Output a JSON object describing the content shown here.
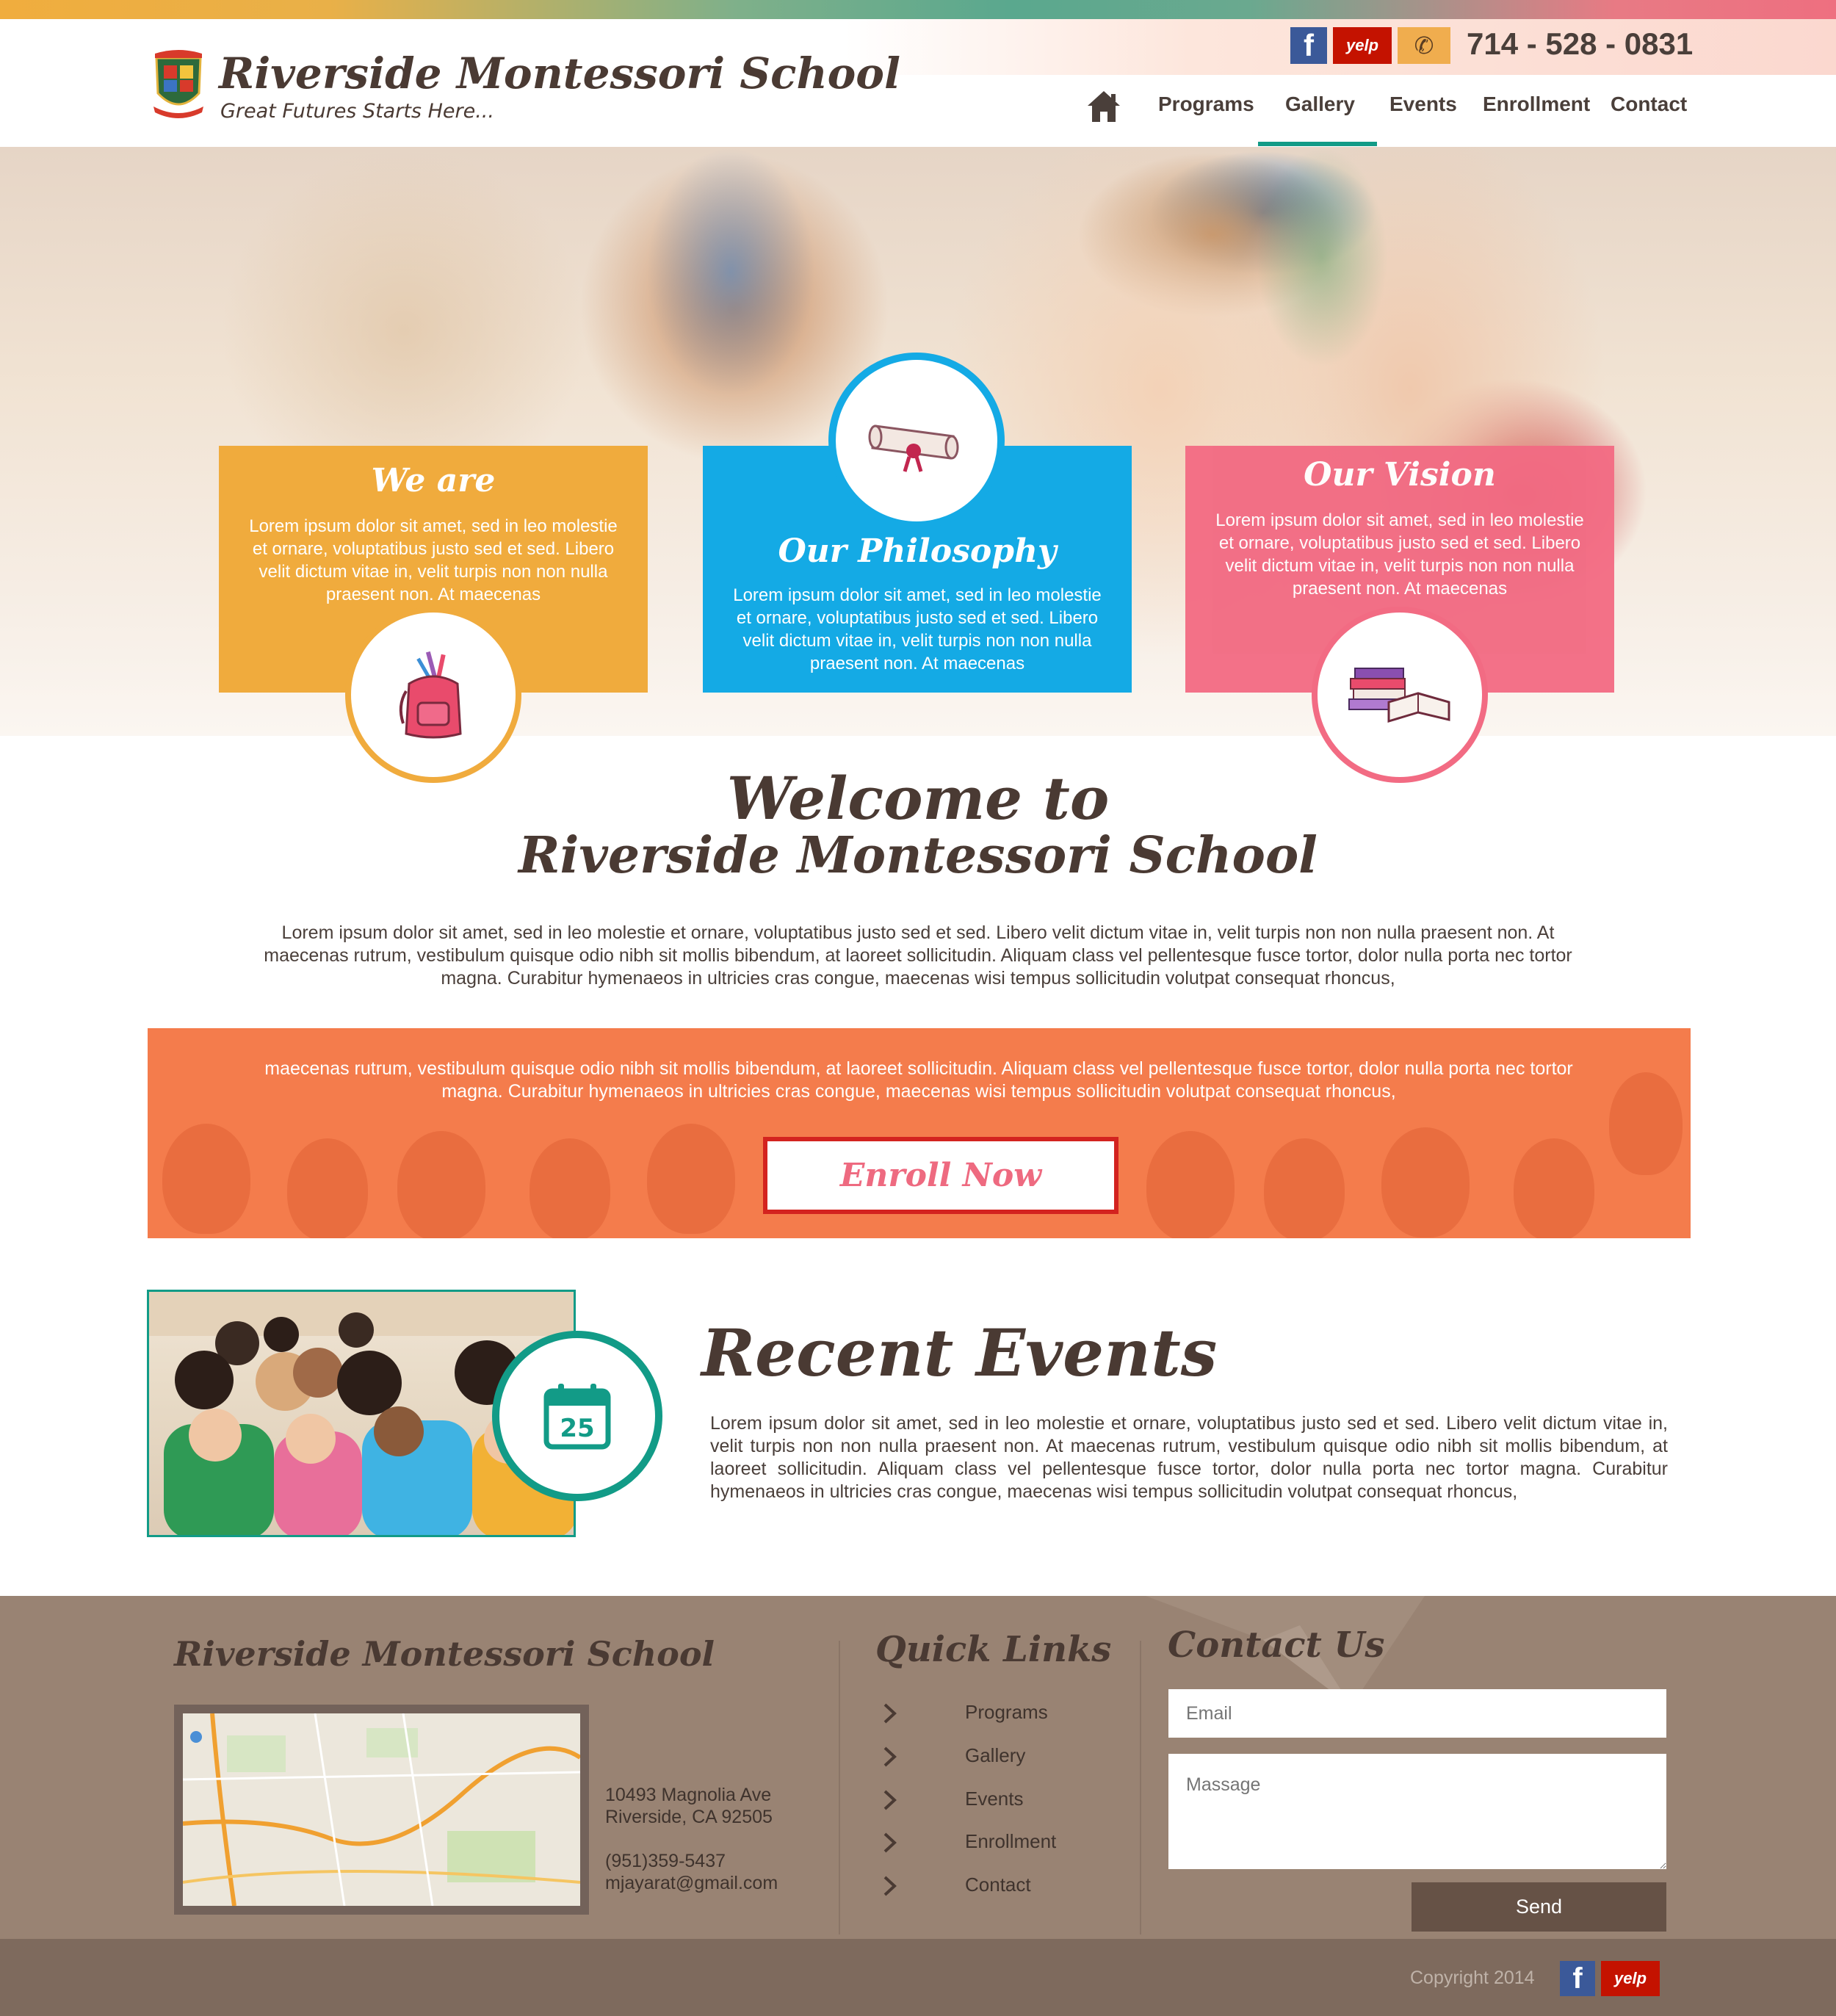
{
  "header": {
    "school_name": "Riverside Montessori School",
    "tagline": "Great Futures Starts Here...",
    "phone": "714 - 528 - 0831",
    "social": {
      "facebook": "f",
      "yelp": "yelp"
    }
  },
  "nav": {
    "items": [
      {
        "label": "Programs"
      },
      {
        "label": "Gallery",
        "active": true
      },
      {
        "label": "Events"
      },
      {
        "label": "Enrollment"
      },
      {
        "label": "Contact"
      }
    ],
    "home_icon": "home-icon"
  },
  "hero": {
    "cards": [
      {
        "title": "We are",
        "text": "Lorem ipsum dolor sit amet, sed in leo molestie et ornare, voluptatibus justo sed et sed. Libero velit dictum vitae in, velit turpis non non nulla praesent non. At maecenas",
        "icon": "school-bag-icon",
        "color": "#f0ab3d"
      },
      {
        "title": "Our Philosophy",
        "text": "Lorem ipsum dolor sit amet, sed in leo molestie et ornare, voluptatibus justo sed et sed. Libero velit dictum vitae in, velit turpis non non nulla praesent non. At maecenas",
        "icon": "diploma-scroll-icon",
        "color": "#14aae5"
      },
      {
        "title": "Our Vision",
        "text": "Lorem ipsum dolor sit amet, sed in leo molestie et ornare, voluptatibus justo sed et sed. Libero velit dictum vitae in, velit turpis non non nulla praesent non. At maecenas",
        "icon": "books-icon",
        "color": "#f26b83"
      }
    ]
  },
  "welcome": {
    "line1": "Welcome to",
    "line2": "Riverside Montessori School",
    "text": "Lorem ipsum dolor sit amet, sed in leo molestie et ornare, voluptatibus justo sed et sed. Libero velit dictum vitae in, velit turpis non non nulla praesent non. At maecenas rutrum, vestibulum quisque odio nibh sit mollis bibendum, at laoreet sollicitudin. Aliquam class vel pellentesque fusce tortor, dolor nulla porta nec tortor magna. Curabitur hymenaeos in ultricies cras congue, maecenas wisi tempus sollicitudin volutpat consequat rhoncus,"
  },
  "enroll": {
    "text": "maecenas rutrum, vestibulum quisque odio nibh sit mollis bibendum, at laoreet sollicitudin. Aliquam class vel pellentesque fusce tortor, dolor nulla porta nec tortor magna. Curabitur hymenaeos in ultricies cras congue, maecenas wisi tempus sollicitudin volutpat consequat rhoncus,",
    "button_label": "Enroll Now",
    "color": "#f47c4c"
  },
  "events": {
    "title": "Recent Events",
    "calendar_day": "25",
    "text": "Lorem ipsum dolor sit amet, sed in leo molestie et ornare, voluptatibus justo sed et sed. Libero velit dictum vitae in, velit turpis non non nulla praesent non. At maecenas rutrum, vestibulum quisque odio nibh sit mollis bibendum, at laoreet sollicitudin. Aliquam class vel pellentesque fusce tortor, dolor nulla porta nec tortor magna. Curabitur hymenaeos in ultricies cras congue, maecenas wisi tempus sollicitudin volutpat consequat rhoncus,"
  },
  "footer": {
    "school_name": "Riverside Montessori School",
    "address_line1": "10493 Magnolia Ave",
    "address_line2": "Riverside, CA 92505",
    "phone": "(951)359-5437",
    "email": "mjayarat@gmail.com",
    "quick_links_title": "Quick Links",
    "quick_links": [
      {
        "label": "Programs"
      },
      {
        "label": "Gallery"
      },
      {
        "label": "Events"
      },
      {
        "label": "Enrollment"
      },
      {
        "label": "Contact"
      }
    ],
    "contact_title": "Contact Us",
    "email_placeholder": "Email",
    "message_placeholder": "Massage",
    "send_label": "Send",
    "copyright": "Copyright 2014"
  }
}
